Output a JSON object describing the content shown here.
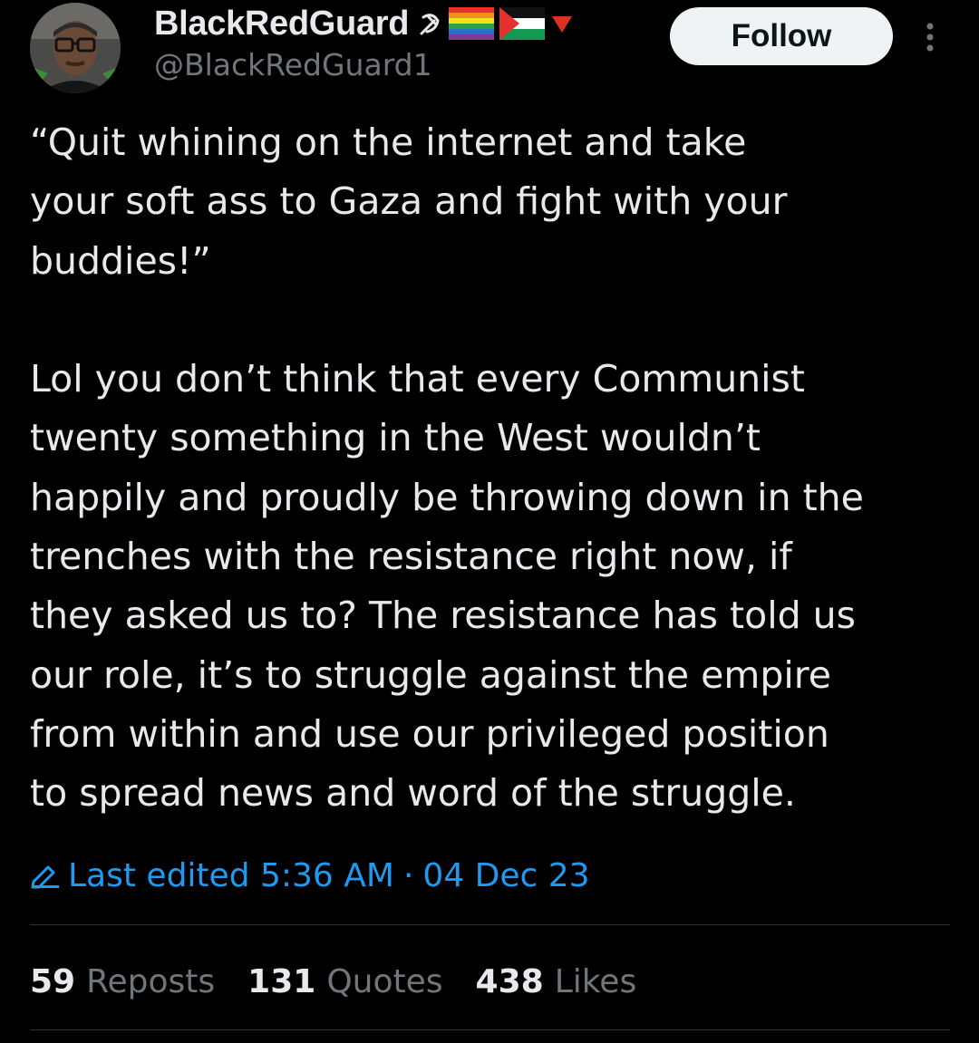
{
  "author": {
    "display_name": "BlackRedGuard",
    "handle": "@BlackRedGuard1",
    "name_emojis": [
      "hammer-sickle-icon",
      "rainbow-flag-icon",
      "palestine-flag-icon",
      "red-triangle-icon"
    ]
  },
  "header": {
    "follow_label": "Follow",
    "more_icon": "more-vertical-icon"
  },
  "tweet": {
    "paragraphs": [
      "“Quit whining on the internet and take\nyour soft ass to Gaza and fight with your\nbuddies!”",
      "Lol you don’t think that every Communist\ntwenty something in the West wouldn’t\nhappily and proudly be throwing down in the\ntrenches with the resistance right now, if\nthey asked us to? The resistance has told us\nour role, it’s to struggle against the empire\nfrom within and use our privileged position\nto spread news and word of the struggle."
    ]
  },
  "edited": {
    "icon": "pencil-icon",
    "label": "Last edited 5:36 AM",
    "separator": "·",
    "date": "04 Dec 23"
  },
  "stats": [
    {
      "count": "59",
      "label": "Reposts"
    },
    {
      "count": "131",
      "label": "Quotes"
    },
    {
      "count": "438",
      "label": "Likes"
    }
  ],
  "colors": {
    "background": "#000000",
    "text_primary": "#e7e9ea",
    "text_secondary": "#71767b",
    "link_blue": "#1d9bf0",
    "divider": "#2f3336",
    "follow_bg": "#eff3f4"
  }
}
